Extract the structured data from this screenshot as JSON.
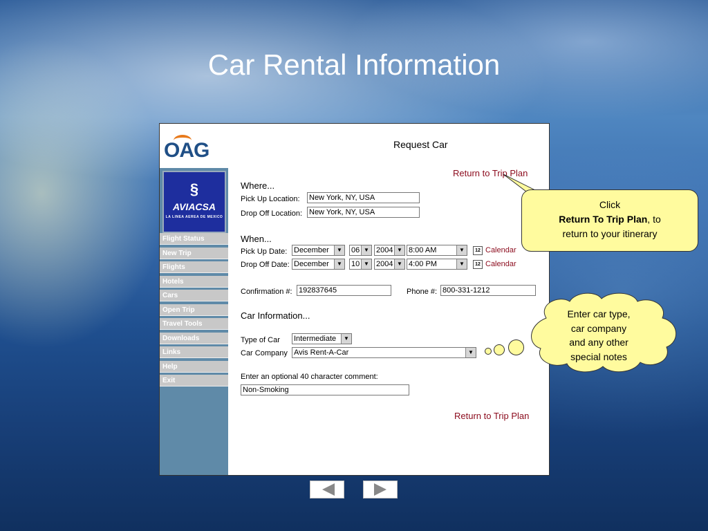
{
  "slide": {
    "title": "Car Rental Information"
  },
  "app": {
    "logo_text": "OAG",
    "page_heading": "Request Car",
    "airline_logo": {
      "name": "AVIACSA",
      "tagline": "LA LINEA AEREA DE MEXICO"
    },
    "nav": [
      "Flight Status",
      "New Trip",
      "Flights",
      "Hotels",
      "Cars",
      "Open Trip",
      "Travel Tools",
      "Downloads",
      "Links",
      "Help",
      "Exit"
    ],
    "return_link_top": "Return to Trip Plan",
    "return_link_bottom": "Return to Trip Plan",
    "where": {
      "heading": "Where...",
      "pickup_label": "Pick Up Location:",
      "pickup_value": "New York, NY, USA",
      "dropoff_label": "Drop Off Location:",
      "dropoff_value": "New York, NY, USA"
    },
    "when": {
      "heading": "When...",
      "pickup_label": "Pick Up Date:",
      "pickup_month": "December",
      "pickup_day": "06",
      "pickup_year": "2004",
      "pickup_time": "8:00 AM",
      "dropoff_label": "Drop Off Date:",
      "dropoff_month": "December",
      "dropoff_day": "10",
      "dropoff_year": "2004",
      "dropoff_time": "4:00 PM",
      "calendar_label": "Calendar",
      "calendar_icon_text": "12"
    },
    "confirmation": {
      "label": "Confirmation #:",
      "value": "192837645",
      "phone_label": "Phone #:",
      "phone_value": "800-331-1212"
    },
    "car_info": {
      "heading": "Car Information...",
      "type_label": "Type of Car",
      "type_value": "Intermediate",
      "company_label": "Car Company",
      "company_value": "Avis Rent-A-Car",
      "comment_label": "Enter an optional 40 character comment:",
      "comment_value": "Non-Smoking"
    }
  },
  "callouts": {
    "return_line1": "Click",
    "return_bold": "Return To Trip Plan",
    "return_line2": ", to",
    "return_line3": "return to your itinerary",
    "cloud_lines": [
      "Enter car type,",
      "car company",
      "and any other",
      "special notes"
    ]
  },
  "icons": {
    "prev": "left-arrow-icon",
    "next": "right-arrow-icon",
    "dropdown": "chevron-down-icon",
    "calendar": "calendar-icon"
  },
  "colors": {
    "link": "#8b0a1c",
    "callout_fill": "#fffb9e",
    "sidebar": "#5f8aa8",
    "airline_logo_bg": "#1e2e9e"
  }
}
